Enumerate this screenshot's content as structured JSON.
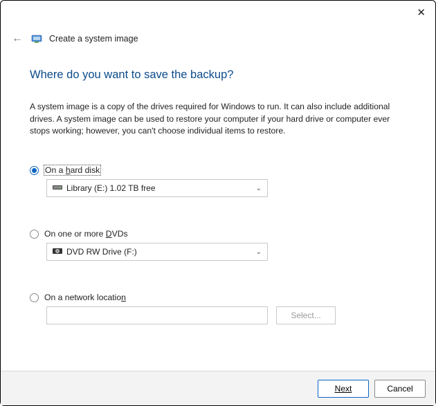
{
  "header": {
    "title": "Create a system image"
  },
  "main": {
    "heading": "Where do you want to save the backup?",
    "description": "A system image is a copy of the drives required for Windows to run. It can also include additional drives. A system image can be used to restore your computer if your hard drive or computer ever stops working; however, you can't choose individual items to restore."
  },
  "options": {
    "hard_disk": {
      "label_pre": "On a ",
      "label_under": "h",
      "label_post": "ard disk",
      "combo_value": "Library (E:)  1.02 TB free"
    },
    "dvd": {
      "label_pre": "On one or more ",
      "label_under": "D",
      "label_post": "VDs",
      "combo_value": "DVD RW Drive (F:)"
    },
    "network": {
      "label_pre": "On a network locatio",
      "label_under": "n",
      "label_post": "",
      "select_btn": "Select..."
    }
  },
  "footer": {
    "next": "Next",
    "cancel": "Cancel"
  }
}
